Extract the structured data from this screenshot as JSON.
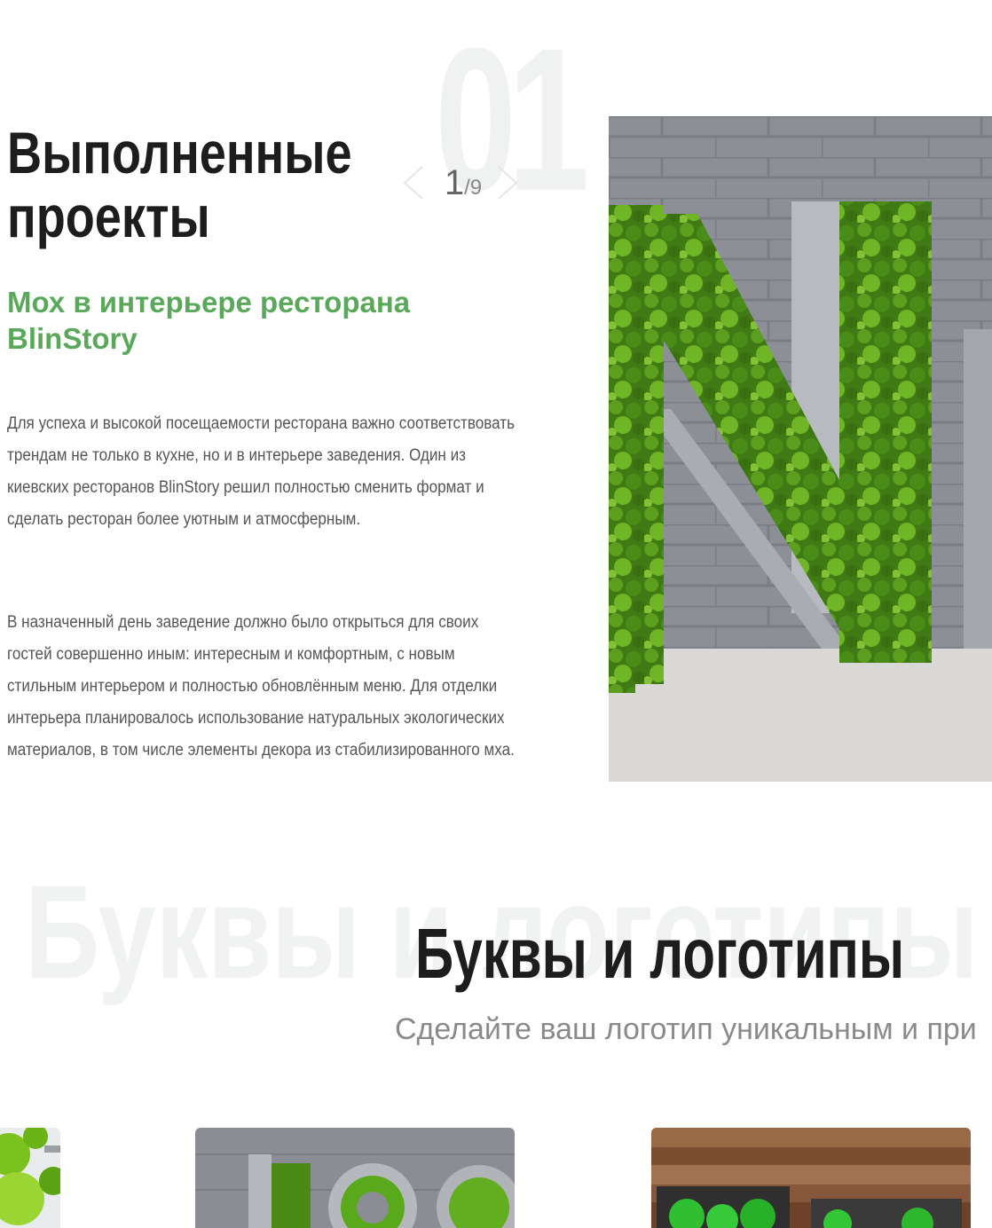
{
  "projects": {
    "big_number": "01",
    "title_line1": "Выполненные",
    "title_line2": "проекты",
    "pager": {
      "current": "1",
      "separator": "/",
      "total": "9",
      "prev_icon": "chevron-left-icon",
      "next_icon": "chevron-right-icon"
    },
    "project_title": "Мох в интерьере ресторана BlinStory",
    "description_p1": "Для успеха и высокой посещаемости ресторана важно соответствовать трендам не только в кухне, но и в интерьере заведения. Один из киевских ресторанов BlinStory решил полностью сменить формат и сделать ресторан более уютным и атмосферным.",
    "description_p2": "В назначенный день заведение должно было открыться для своих гостей совершенно иным: интересным и комфортным, с новым стильным интерьером и полностью обновлённым меню. Для отделки интерьера планировалось использование натуральных экологических материалов, в том числе элементы декора из стабилизированного мха."
  },
  "letters": {
    "ghost_text": "Буквы и логотипы",
    "title": "Буквы и логотипы",
    "subtitle": "Сделайте ваш логотип уникальным и при"
  },
  "colors": {
    "accent_green": "#5aa85a",
    "title_dark": "#1d1d1d",
    "body_text": "#555555",
    "ghost_text": "#f1f2f2"
  }
}
